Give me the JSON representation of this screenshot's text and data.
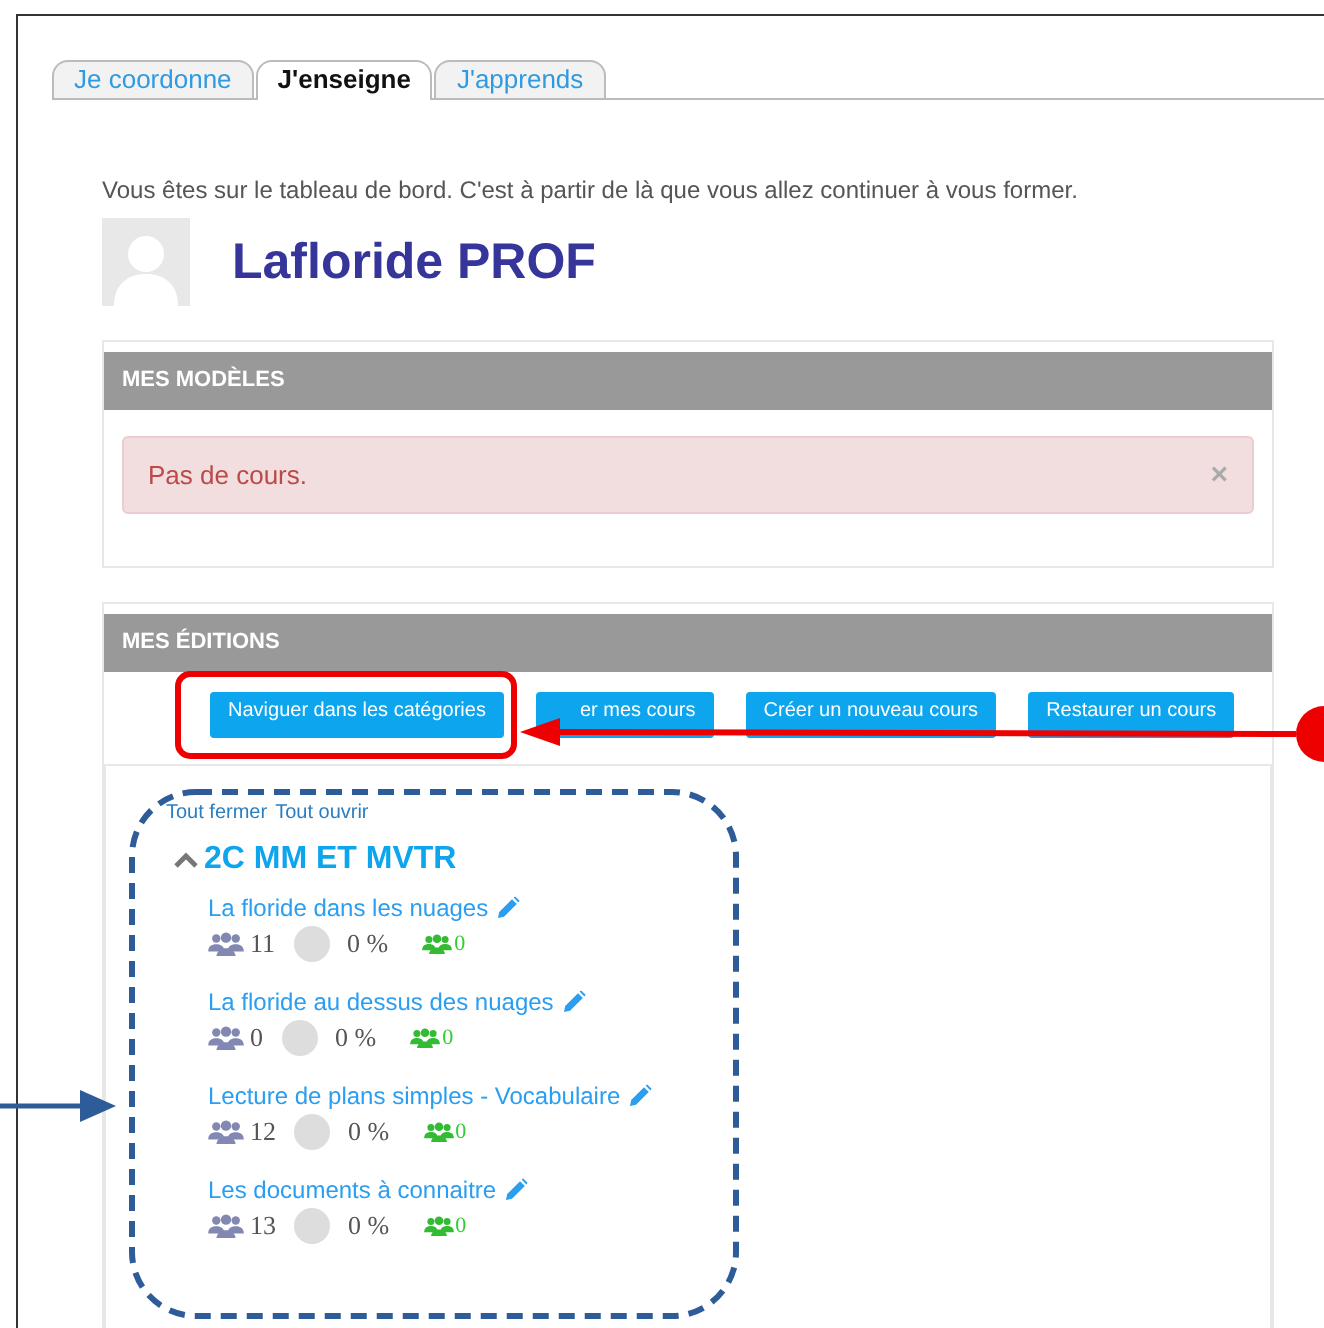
{
  "tabs": [
    {
      "label": "Je coordonne",
      "selected": false
    },
    {
      "label": "J'enseigne",
      "selected": true
    },
    {
      "label": "J'apprends",
      "selected": false
    }
  ],
  "intro": "Vous êtes sur le tableau de bord. C'est à partir de là que vous allez continuer à vous former.",
  "user": {
    "name": "Lafloride PROF"
  },
  "models_panel": {
    "title": "MES MODÈLES",
    "alert": {
      "text": "Pas de cours.",
      "close": "×"
    }
  },
  "editions_panel": {
    "title": "MES ÉDITIONS",
    "buttons": [
      "Naviguer dans les catégories",
      "er mes cours",
      "Créer un nouveau cours",
      "Restaurer un cours"
    ],
    "links": [
      "Tout fermer",
      "Tout ouvrir"
    ],
    "category": {
      "title": "2C MM ET MVTR",
      "expanded": true,
      "courses": [
        {
          "title": "La floride dans les nuages",
          "students": "11",
          "progress": "0 %",
          "groups": "0"
        },
        {
          "title": "La floride au dessus des nuages",
          "students": "0",
          "progress": "0 %",
          "groups": "0"
        },
        {
          "title": "Lecture de plans simples - Vocabulaire",
          "students": "12",
          "progress": "0 %",
          "groups": "0"
        },
        {
          "title": "Les documents à connaitre",
          "students": "13",
          "progress": "0 %",
          "groups": "0"
        }
      ]
    }
  }
}
